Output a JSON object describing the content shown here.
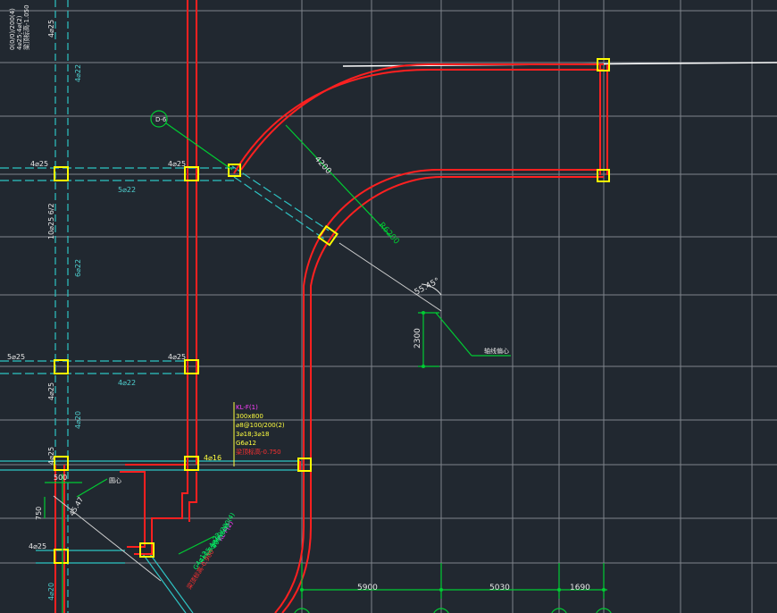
{
  "colors": {
    "background": "#212830",
    "grid": "#8f959b",
    "beam": "#ff2020",
    "rebar": "#2ec4c4",
    "column": "#ffff00",
    "dim": "#00cc33",
    "text_white": "#e8e8e8",
    "text_cyan": "#4fd0d0",
    "text_yellow": "#ffff40",
    "text_magenta": "#ff40ff",
    "text_red": "#ff3030"
  },
  "labels": {
    "beam_left_top": "4⌀25",
    "beam_left_mid": "5⌀25",
    "beam_left_bot": "4⌀25",
    "beam_left_low": "4⌀25",
    "beam_center_top": "4⌀25",
    "beam_center_mid": "4⌀25",
    "beam_center_bot": "4⌀16",
    "span_text_1": "5⌀22",
    "span_text_2": "4⌀22",
    "vert_text_1": "4⌀22",
    "vert_text_2": "6⌀22",
    "vert_text_3": "10⌀25 6/2",
    "vert_text_4": "4⌀25",
    "vert_text_5": "4⌀20",
    "vert_text_6": "4⌀25",
    "vert_text_7": "4⌀20",
    "vert_text_top": "4⌀25",
    "section_marker": "D-6",
    "arc_dim_1": "4200",
    "arc_dim_2": "R6200",
    "angle_dim": "55.45°",
    "vert_dim": "2300",
    "small_dim_1": "500",
    "small_dim_2": "750",
    "small_dim_3": "45.47",
    "bottom_dim_1": "5900",
    "bottom_dim_2": "5030",
    "bottom_dim_3": "1690",
    "leader_text": "轴线偏心",
    "round_text": "圆心",
    "top_notes": [
      "0(0/0)/200(4)",
      "4⌀25;4⌀(2)",
      "梁顶标高-1.050"
    ],
    "kl_title": "KL-F(1)",
    "kl_lines": [
      "300x800",
      "⌀8@100/200(2)",
      "3⌀18;3⌀18",
      "G6⌀12"
    ],
    "kl_note": "梁顶标高-0.750",
    "kl_lower_lines": [
      "KL-F(2)",
      "400x800",
      "⌀8@100/200(4)",
      "4⌀25;4⌀22",
      "G4⌀12",
      "梁顶标高-0.900"
    ]
  }
}
